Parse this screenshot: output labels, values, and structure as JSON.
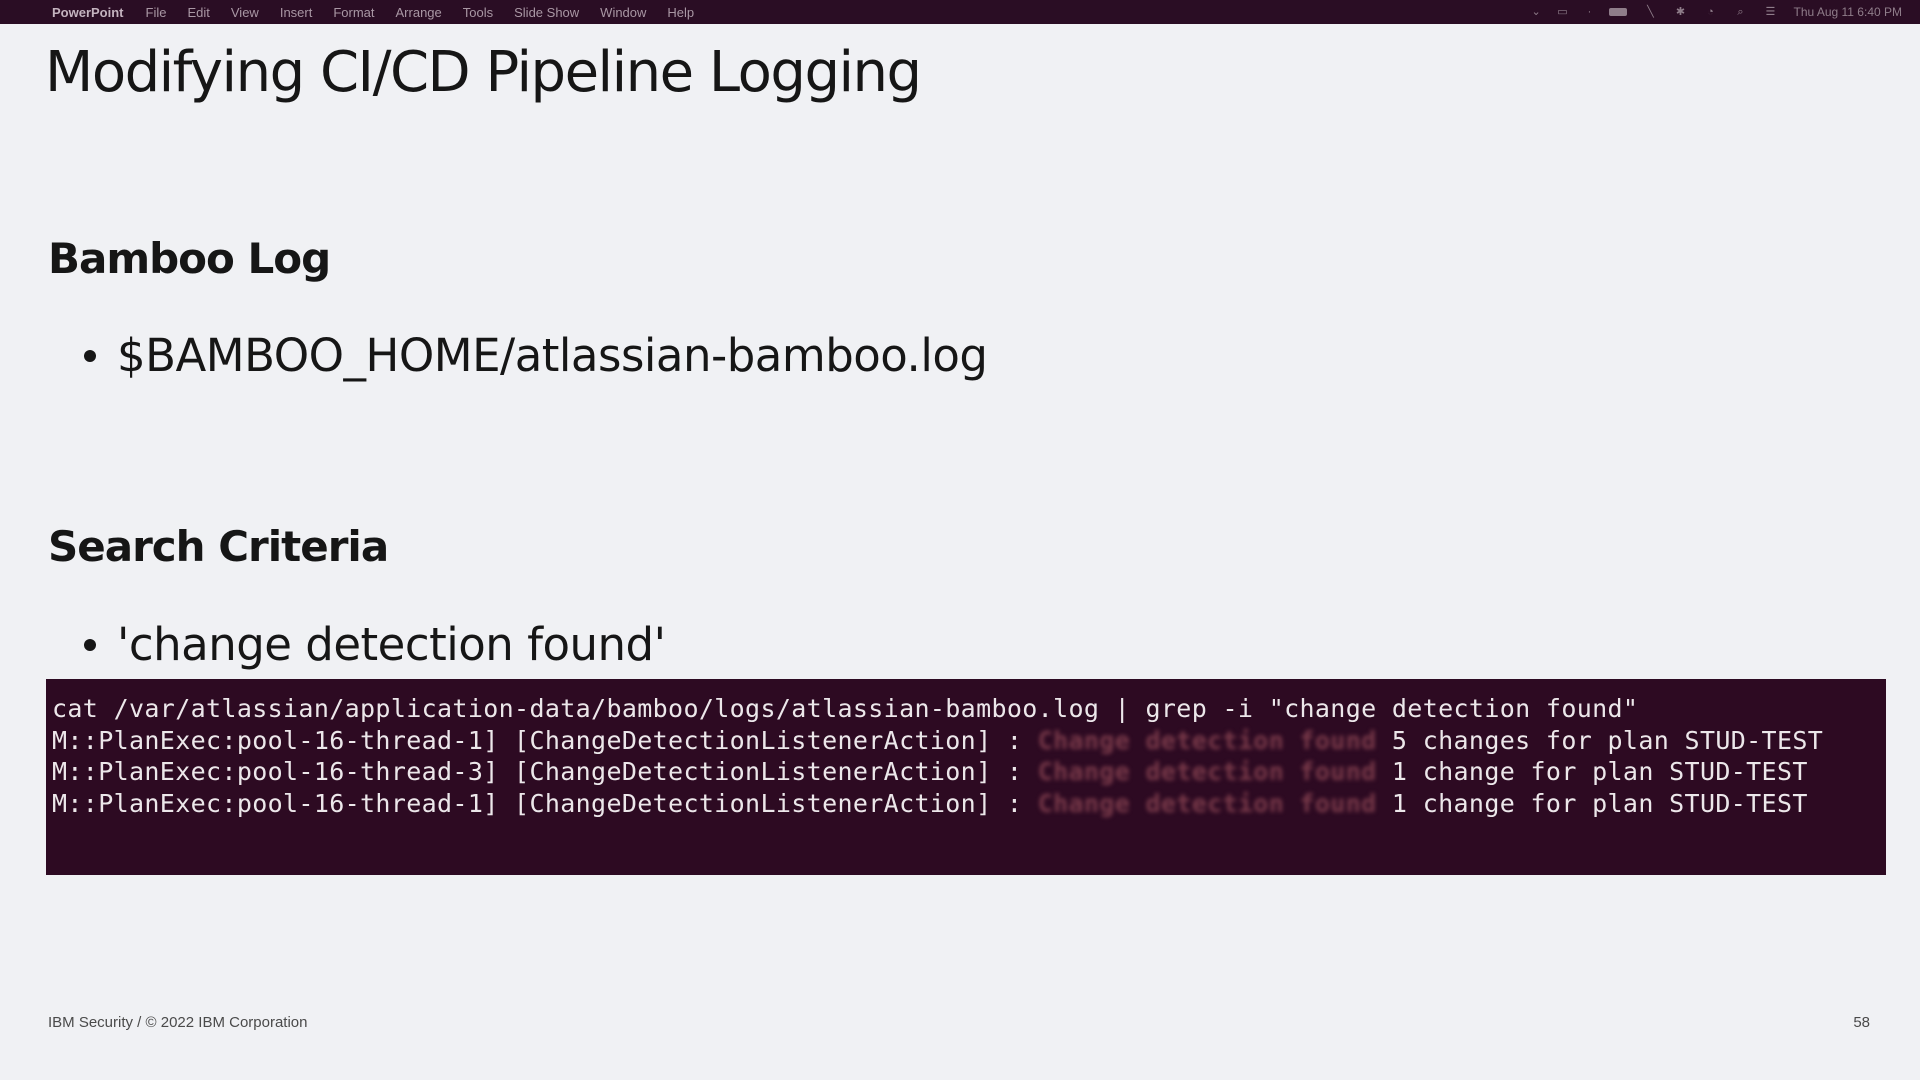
{
  "menubar": {
    "apple_icon": "apple-logo-icon",
    "app_name": "PowerPoint",
    "menus": [
      "File",
      "Edit",
      "View",
      "Insert",
      "Format",
      "Arrange",
      "Tools",
      "Slide Show",
      "Window",
      "Help"
    ],
    "clock": "Thu Aug 11  6:40 PM"
  },
  "slide": {
    "title": "Modifying CI/CD Pipeline Logging",
    "sections": [
      {
        "heading": "Bamboo Log",
        "bullet": "$BAMBOO_HOME/atlassian-bamboo.log"
      },
      {
        "heading": "Search Criteria",
        "bullet": "'change detection found'"
      }
    ],
    "terminal": {
      "command": "cat /var/atlassian/application-data/bamboo/logs/atlassian-bamboo.log | grep -i \"change detection found\"",
      "lines": [
        {
          "prefix": "M::PlanExec:pool-16-thread-1] [ChangeDetectionListenerAction] : ",
          "match": "Change detection found",
          "suffix": " 5 changes for plan STUD-TEST"
        },
        {
          "prefix": "M::PlanExec:pool-16-thread-3] [ChangeDetectionListenerAction] : ",
          "match": "Change detection found",
          "suffix": " 1 change for plan STUD-TEST"
        },
        {
          "prefix": "M::PlanExec:pool-16-thread-1] [ChangeDetectionListenerAction] : ",
          "match": "Change detection found",
          "suffix": " 1 change for plan STUD-TEST"
        }
      ]
    },
    "footer": {
      "copyright": "IBM Security / © 2022 IBM Corporation",
      "page_number": "58"
    }
  }
}
